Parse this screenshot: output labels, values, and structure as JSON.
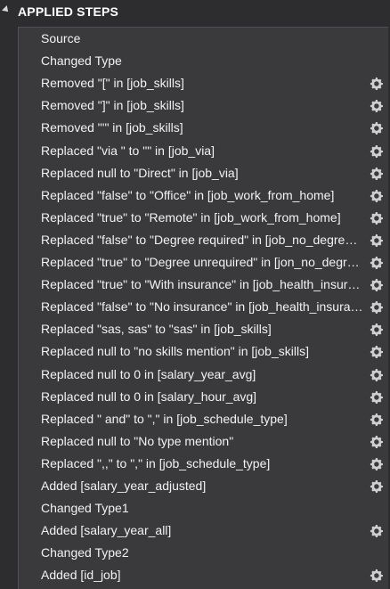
{
  "panel": {
    "title": "APPLIED STEPS"
  },
  "steps": [
    {
      "label": "Source",
      "has_settings": false
    },
    {
      "label": "Changed Type",
      "has_settings": false
    },
    {
      "label": "Removed \"[\" in [job_skills]",
      "has_settings": true
    },
    {
      "label": "Removed \"]\" in [job_skills]",
      "has_settings": true
    },
    {
      "label": "Removed \"'\" in [job_skills]",
      "has_settings": true
    },
    {
      "label": "Replaced \"via \" to \"\" in [job_via]",
      "has_settings": true
    },
    {
      "label": "Replaced null to \"Direct\" in [job_via]",
      "has_settings": true
    },
    {
      "label": "Replaced \"false\" to \"Office\" in [job_work_from_home]",
      "has_settings": true
    },
    {
      "label": "Replaced \"true\" to \"Remote\" in [job_work_from_home]",
      "has_settings": true
    },
    {
      "label": "Replaced \"false\" to \"Degree required\" in [job_no_degree_mention]",
      "has_settings": true
    },
    {
      "label": "Replaced \"true\" to \"Degree unrequired\" in [jon_no_degree_mention]",
      "has_settings": true
    },
    {
      "label": "Replaced \"true\" to \"With insurance\" in [job_health_insurance]",
      "has_settings": true
    },
    {
      "label": "Replaced \"false\" to \"No insurance\" in [job_health_insurance]",
      "has_settings": true
    },
    {
      "label": "Replaced \"sas, sas\" to \"sas\" in [job_skills]",
      "has_settings": true
    },
    {
      "label": "Replaced null to \"no skills mention\" in [job_skills]",
      "has_settings": true
    },
    {
      "label": "Replaced null to 0 in [salary_year_avg]",
      "has_settings": true
    },
    {
      "label": "Replaced null to 0 in [salary_hour_avg]",
      "has_settings": true
    },
    {
      "label": "Replaced \" and\" to \",\" in [job_schedule_type]",
      "has_settings": true
    },
    {
      "label": "Replaced null to \"No type mention\"",
      "has_settings": true
    },
    {
      "label": "Replaced \",,\" to \",\" in [job_schedule_type]",
      "has_settings": true
    },
    {
      "label": "Added [salary_year_adjusted]",
      "has_settings": true
    },
    {
      "label": "Changed Type1",
      "has_settings": false
    },
    {
      "label": "Added [salary_year_all]",
      "has_settings": true
    },
    {
      "label": "Changed Type2",
      "has_settings": false
    },
    {
      "label": "Added [id_job]",
      "has_settings": true
    }
  ]
}
